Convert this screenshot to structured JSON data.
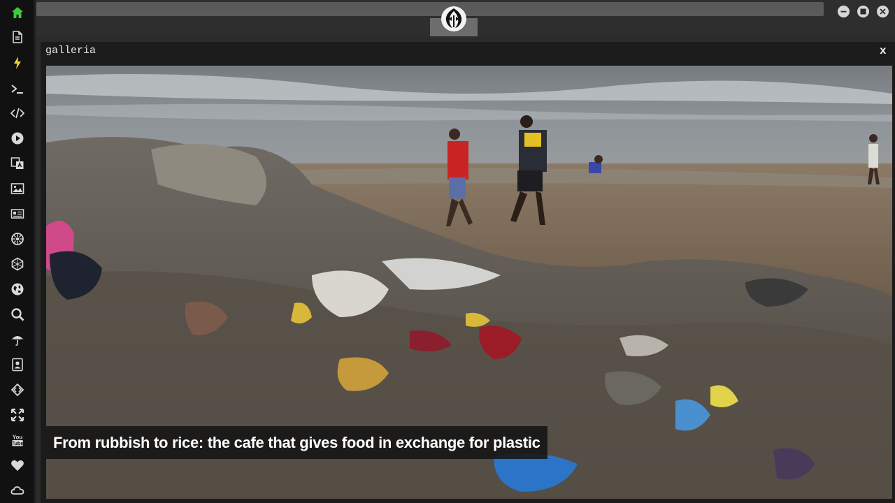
{
  "sidebar": {
    "items": [
      {
        "icon": "home-icon",
        "active": true
      },
      {
        "icon": "document-icon"
      },
      {
        "icon": "lightning-icon"
      },
      {
        "icon": "terminal-icon"
      },
      {
        "icon": "code-icon"
      },
      {
        "icon": "play-icon"
      },
      {
        "icon": "translate-icon"
      },
      {
        "icon": "image-icon"
      },
      {
        "icon": "newspaper-icon"
      },
      {
        "icon": "settings-wheel-icon"
      },
      {
        "icon": "hexagon-icon"
      },
      {
        "icon": "globe-icon"
      },
      {
        "icon": "search-icon"
      },
      {
        "icon": "umbrella-icon"
      },
      {
        "icon": "contact-card-icon"
      },
      {
        "icon": "swap-code-icon"
      },
      {
        "icon": "expand-icon"
      },
      {
        "icon": "youtube-icon",
        "label": "You Tube"
      },
      {
        "icon": "heart-icon"
      },
      {
        "icon": "cloud-icon"
      }
    ]
  },
  "colors": {
    "active_icon": "#3ec93e",
    "icon": "#d8d8d8",
    "accent_bar": "#f1d23a"
  },
  "panel": {
    "title": "galleria",
    "close_label": "x",
    "caption": "From rubbish to rice: the cafe that gives food in exchange for plastic",
    "image_subject": "beach-covered-in-plastic-waste"
  }
}
